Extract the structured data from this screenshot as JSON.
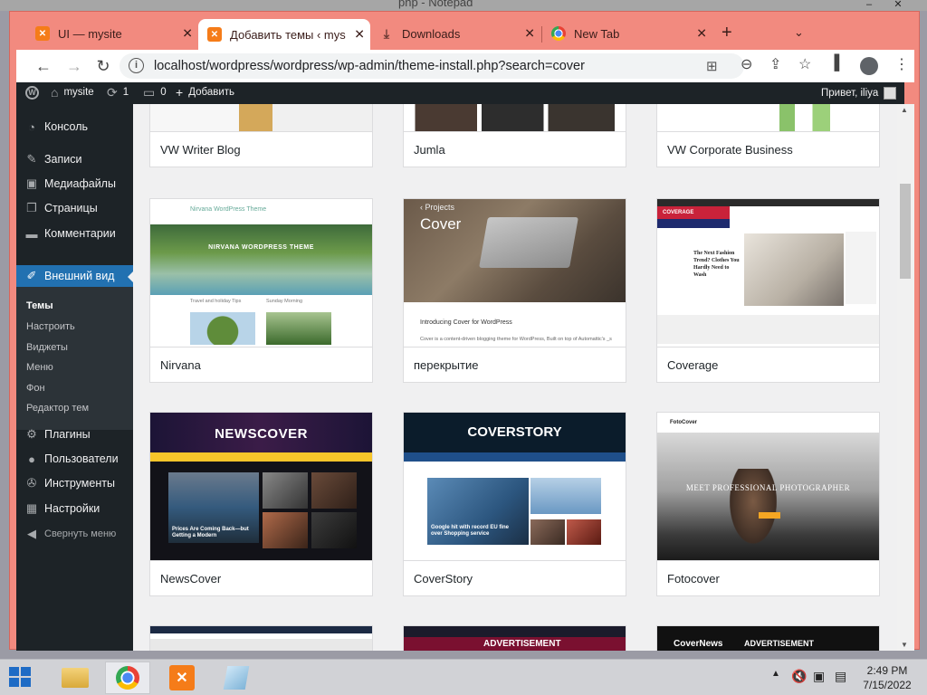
{
  "desktop": {
    "window_title_fragment": "php - Notepad"
  },
  "browser": {
    "tabs": [
      {
        "label": "UI — mysite",
        "favicon": "xampp-icon",
        "active": false
      },
      {
        "label": "Добавить темы ‹ mysit",
        "favicon": "xampp-icon",
        "active": true
      },
      {
        "label": "Downloads",
        "favicon": "download-icon",
        "active": false
      },
      {
        "label": "New Tab",
        "favicon": "chrome-icon",
        "active": false
      }
    ],
    "url": "localhost/wordpress/wordpress/wp-admin/theme-install.php?search=cover"
  },
  "admin_bar": {
    "site_name": "mysite",
    "updates_count": "1",
    "comments_count": "0",
    "new_label": "Добавить",
    "greeting": "Привет, iliya"
  },
  "sidebar": {
    "items": [
      {
        "label": "Консоль",
        "icon": "dashboard-icon"
      },
      {
        "label": "Записи",
        "icon": "pin-icon"
      },
      {
        "label": "Медиафайлы",
        "icon": "media-icon"
      },
      {
        "label": "Страницы",
        "icon": "pages-icon"
      },
      {
        "label": "Комментарии",
        "icon": "comment-icon"
      },
      {
        "label": "Внешний вид",
        "icon": "brush-icon",
        "current": true
      },
      {
        "label": "Плагины",
        "icon": "plugin-icon"
      },
      {
        "label": "Пользователи",
        "icon": "users-icon"
      },
      {
        "label": "Инструменты",
        "icon": "wrench-icon"
      },
      {
        "label": "Настройки",
        "icon": "settings-icon"
      },
      {
        "label": "Свернуть меню",
        "icon": "collapse-icon"
      }
    ],
    "submenu": [
      "Темы",
      "Настроить",
      "Виджеты",
      "Меню",
      "Фон",
      "Редактор тем"
    ]
  },
  "themes": {
    "row0": [
      "VW Writer Blog",
      "Jumla",
      "VW Corporate Business"
    ],
    "row1": [
      "Nirvana",
      "перекрытие",
      "Coverage"
    ],
    "row2": [
      "NewsCover",
      "CoverStory",
      "Fotocover"
    ]
  },
  "screenshots": {
    "nirvana": {
      "site_title": "Nirvana WordPress Theme",
      "hero": "NIRVANA WORDPRESS THEME",
      "col1": "Travel and holiday Tips",
      "col2": "Sunday Morning"
    },
    "cover": {
      "sub": "‹ Projects",
      "title": "Cover",
      "intro": "Introducing Cover for WordPress",
      "body": "Cover is a content-driven blogging theme for WordPress, Built on top of Automattic's _s"
    },
    "coverage": {
      "logo": "COVERAGE",
      "headline": "The Next Fashion Trend? Clothes You Hardly Need to Wash"
    },
    "newscover": {
      "title": "NEWSCOVER",
      "caption": "Prices Are Coming Back—but Getting a Modern"
    },
    "coverstory": {
      "title": "COVERSTORY",
      "caption": "Google hit with record EU fine over Shopping service"
    },
    "fotocover": {
      "logo": "FotoCover",
      "headline": "MEET PROFESSIONAL PHOTOGRAPHER"
    },
    "peek": {
      "ad1": "ADVERTISEMENT",
      "logo3": "CoverNews",
      "ad3": "ADVERTISEMENT"
    }
  },
  "taskbar": {
    "time": "2:49 PM",
    "date": "7/15/2022"
  }
}
